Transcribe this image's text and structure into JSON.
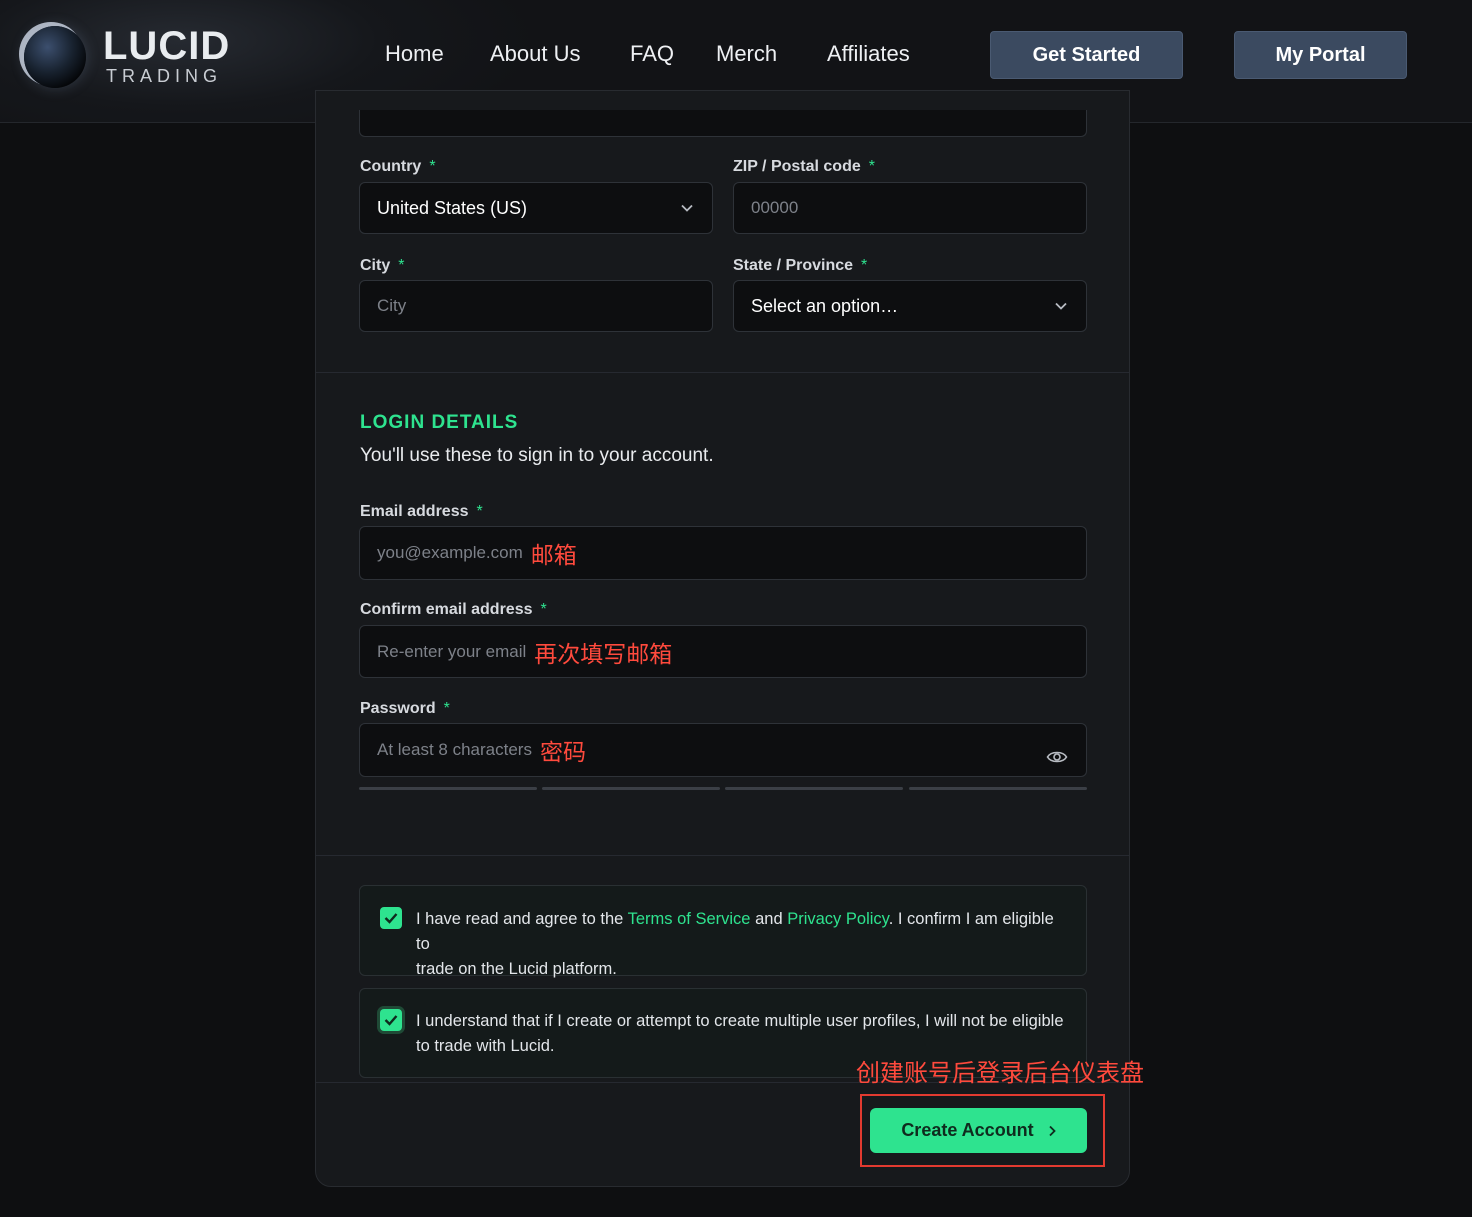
{
  "header": {
    "logo_main": "LUCID",
    "logo_sub": "TRADING",
    "nav": [
      "Home",
      "About Us",
      "FAQ",
      "Merch",
      "Affiliates"
    ],
    "get_started": "Get Started",
    "my_portal": "My Portal"
  },
  "address": {
    "country_label": "Country",
    "country_value": "United States (US)",
    "zip_label": "ZIP / Postal code",
    "zip_placeholder": "00000",
    "city_label": "City",
    "city_placeholder": "City",
    "state_label": "State / Province",
    "state_value": "Select an option…"
  },
  "login": {
    "title": "LOGIN DETAILS",
    "subtitle": "You'll use these to sign in to your account.",
    "email_label": "Email address",
    "email_placeholder": "you@example.com",
    "email_annotation": "邮箱",
    "confirm_label": "Confirm email address",
    "confirm_placeholder": "Re-enter your email",
    "confirm_annotation": "再次填写邮箱",
    "password_label": "Password",
    "password_placeholder": "At least 8 characters",
    "password_annotation": "密码"
  },
  "agreements": {
    "terms_prefix": "I have read and agree to the",
    "terms_link": "Terms of Service",
    "terms_and": "and",
    "privacy_link": "Privacy Policy",
    "terms_suffix_1": ". I confirm I am eligible to",
    "terms_suffix_2": "trade on the Lucid platform.",
    "multi_line1": "I understand that if I create or attempt to create multiple user profiles, I will not be eligible",
    "multi_line2": "to trade with Lucid.",
    "terms_checked": true,
    "multi_checked": true
  },
  "submit": {
    "label": "Create Account",
    "annotation": "创建账号后登录后台仪表盘"
  },
  "required_marker": "*",
  "colors": {
    "accent": "#2ee38f",
    "annotation": "#ff4a3d",
    "header_button": "#3b4a60"
  }
}
